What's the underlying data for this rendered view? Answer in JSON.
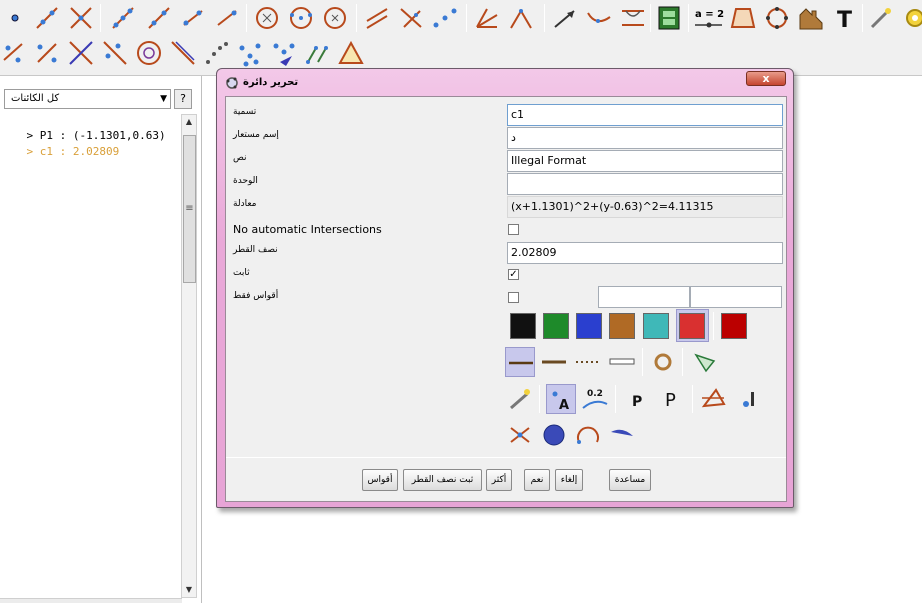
{
  "toolbar": {
    "row1_icons": [
      "point-tool",
      "line-tool",
      "intersect-tool",
      "segment-tool",
      "ray-tool",
      "vector-tool",
      "line-through-points-tool",
      "circle-center-point-tool",
      "circle-through-points-tool",
      "circle-radius-tool",
      "parallel-line-tool",
      "perpendicular-tool",
      "midpoint-tool",
      "angle-bisector-tool",
      "tangents-tool",
      "vector-arrow-tool",
      "function-tool",
      "locus-tool",
      "movie-tool",
      "slider-tool",
      "polygon-tool",
      "conic-tool",
      "image-tool",
      "text-tool",
      "magic-wand-tool",
      "settings-tool"
    ],
    "slider_label": "a = 2",
    "text_tool_label": "T",
    "row2_icons": [
      "point-on-object-tool",
      "slope-tool",
      "perpendicular-bisector-tool",
      "mirror-tool",
      "circle-tool",
      "diameter-tool",
      "dotted-curve-tool",
      "scatter-tool",
      "regression-tool",
      "locus-points-tool",
      "triangle-tool"
    ]
  },
  "algebra": {
    "filter_value": "كل الكائنات",
    "help_label": "?",
    "lines": [
      {
        "prefix": "> ",
        "text": "P1 : (-1.1301,0.63)",
        "color": "#000000"
      },
      {
        "prefix": "> ",
        "text": "c1 : 2.02809",
        "color": "#d9a03a"
      }
    ],
    "scroll_grip": "≡"
  },
  "dialog": {
    "title": "تحرير دائرة",
    "close_label": "x",
    "fields": {
      "name_label": "تسمية",
      "name_value": "c1",
      "alias_label": "إسم مستعار",
      "alias_value": "د",
      "text_label": "نص",
      "text_value": "Illegal Format",
      "unit_label": "الوحدة",
      "unit_value": "",
      "equation_label": "معادلة",
      "equation_value": "(x+1.1301)^2+(y-0.63)^2=4.11315",
      "no_intersections_label": "No automatic Intersections",
      "no_intersections_checked": false,
      "radius_label": "نصف القطر",
      "radius_value": "2.02809",
      "fixed_label": "ثابت",
      "fixed_checked": true,
      "arcs_only_label": "أقواس فقط",
      "arcs_only_checked": false
    },
    "colors": [
      "#111111",
      "#1e8a2a",
      "#2a3fcf",
      "#b06a25",
      "#3fb8b8",
      "#d93030",
      "#bb0000"
    ],
    "selected_color_index": 5,
    "line_styles": [
      "solid-line",
      "thick-line",
      "dotted-line",
      "dashed-line"
    ],
    "selected_line_style": 0,
    "buttons": {
      "arcs": "أقواس",
      "fix_radius": "ثبت نصف القطر",
      "more": "أكثر",
      "yes": "نعم",
      "cancel": "إلغاء",
      "help": "مساعدة"
    }
  }
}
